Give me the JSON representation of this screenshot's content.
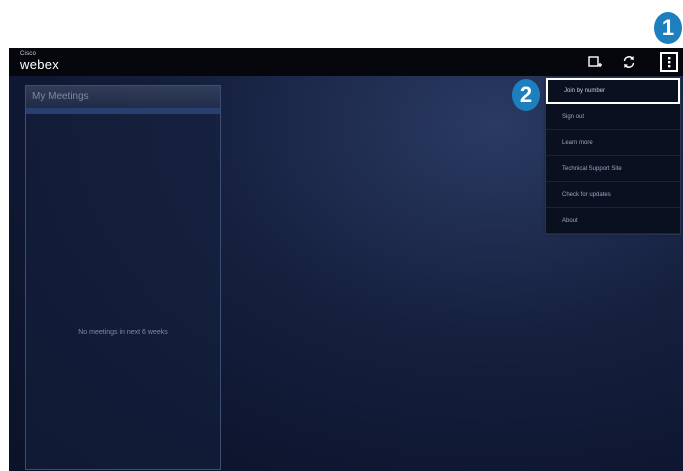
{
  "app": {
    "logo_small": "Cisco",
    "logo_main": "webex"
  },
  "toolbar": {
    "add_icon": "add-meeting-icon",
    "refresh_icon": "refresh-icon",
    "overflow_icon": "overflow-menu-icon"
  },
  "meetings_panel": {
    "title": "My Meetings",
    "empty_message": "No meetings in next 6 weeks"
  },
  "overflow_menu": {
    "items": [
      {
        "label": "Join by number",
        "highlighted": true
      },
      {
        "label": "Sign out"
      },
      {
        "label": "Learn more"
      },
      {
        "label": "Technical Support Site"
      },
      {
        "label": "Check for updates"
      },
      {
        "label": "About"
      }
    ]
  },
  "callouts": {
    "one": "1",
    "two": "2"
  },
  "colors": {
    "callout": "#1e7fbf",
    "topbar": "#05070d",
    "background": "#16213f"
  }
}
